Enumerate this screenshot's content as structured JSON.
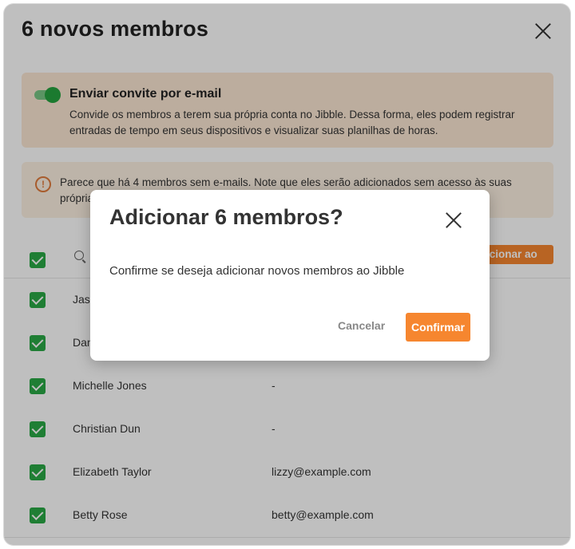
{
  "panel": {
    "title": "6 novos membros",
    "invite": {
      "enabled": true,
      "title": "Enviar convite por e-mail",
      "description": "Convide os membros a terem sua própria conta no Jibble. Dessa forma, eles podem registrar entradas de tempo em seus dispositivos e visualizar suas planilhas de horas."
    },
    "warning": {
      "icon": "exclamation-circle-icon",
      "text": "Parece que há 4 membros sem e-mails. Note que eles serão adicionados sem acesso às suas próprias contas."
    },
    "table": {
      "add_button_label": "Adicionar ao Jibble",
      "rows": [
        {
          "name": "Jason",
          "email": "",
          "checked": true
        },
        {
          "name": "Daniel",
          "email": "",
          "checked": true
        },
        {
          "name": "Michelle Jones",
          "email": "-",
          "checked": true
        },
        {
          "name": "Christian Dun",
          "email": "-",
          "checked": true
        },
        {
          "name": "Elizabeth Taylor",
          "email": "lizzy@example.com",
          "checked": true
        },
        {
          "name": "Betty Rose",
          "email": "betty@example.com",
          "checked": true
        }
      ]
    }
  },
  "modal": {
    "title": "Adicionar 6 membros?",
    "message": "Confirme se deseja adicionar novos membros ao Jibble",
    "cancel_label": "Cancelar",
    "confirm_label": "Confirmar"
  },
  "colors": {
    "accent": "#f6862f",
    "checkbox": "#2aa846",
    "invite_bg": "#fbe7d3",
    "warning_bg": "#fdf1e2"
  }
}
